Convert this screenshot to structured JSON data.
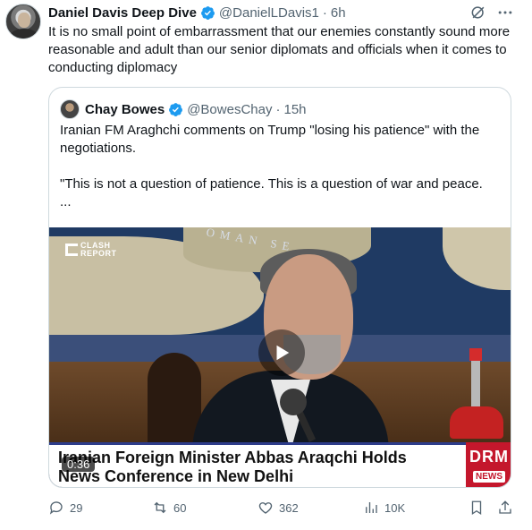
{
  "post": {
    "author_name": "Daniel Davis Deep Dive",
    "author_handle": "@DanielLDavis1",
    "separator": "·",
    "time": "6h",
    "text": "It is no small point of embarrassment that our enemies constantly sound more reasonable and adult than our senior diplomats and officials when it comes to conducting diplomacy",
    "icons": [
      "grok-icon",
      "more-icon"
    ]
  },
  "quote": {
    "author_name": "Chay Bowes",
    "author_handle": "@BowesChay",
    "separator": "·",
    "time": "15h",
    "text_line1": "Iranian FM Araghchi comments on Trump \"losing his patience\" with the negotiations.",
    "text_line2": "\"This is not a question of patience. This is a question of war and peace.",
    "text_line3": "..."
  },
  "video": {
    "duration": "0:36",
    "banner": "Iranian Foreign Minister Abbas Araqchi Holds News Conference in New Delhi",
    "channel_logo": "CLASH REPORT",
    "logo_line1": "CLASH",
    "logo_line2": "REPORT",
    "drm_line1": "DRM",
    "drm_line2": "NEWS",
    "sea_label": "OMAN SE"
  },
  "actions": {
    "replies": "29",
    "reposts": "60",
    "likes": "362",
    "views": "10K"
  },
  "colors": {
    "verified": "#1d9bf0",
    "secondary_text": "#536471",
    "border": "#cfd9de"
  }
}
